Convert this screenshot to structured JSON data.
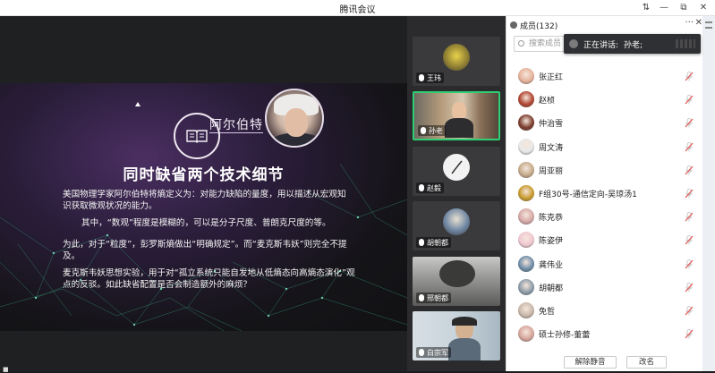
{
  "app": {
    "title": "腾讯会议",
    "window_controls": {
      "pin_icon": "pin-icon",
      "minimize": "—",
      "restore": "⧉",
      "close": "✕"
    }
  },
  "slide": {
    "person_name": "阿尔伯特",
    "headline": "同时缺省两个技术细节",
    "paragraphs": [
      "美国物理学家阿尔伯特将熵定义为：对能力缺陷的量度，用以描述从宏观知识获取微观状况的能力。",
      "其中，“数观”程度是模糊的，可以是分子尺度、普朗克尺度的等。",
      "为此，对于“粒度”，彭罗斯熵做出“明确规定”。而“麦克斯韦妖”则完全不提及。",
      "麦克斯韦妖思想实验，用于对“孤立系统只能自发地从低熵态向高熵态演化”观点的反驳。如此缺省配置是否会制造额外的麻烦？"
    ]
  },
  "video_tiles": [
    {
      "name": "王玮",
      "avatar_color": "#8a7a32",
      "active": false
    },
    {
      "name": "孙老",
      "avatar_color": "#b39a7a",
      "active": true
    },
    {
      "name": "赵毅",
      "avatar_color": "#eeeeee",
      "active": false
    },
    {
      "name": "胡朝都",
      "avatar_color": "#6f86a3",
      "active": false
    },
    {
      "name": "邢朝都",
      "avatar_color": "#9a9a98",
      "active": false
    },
    {
      "name": "白宗军",
      "avatar_color": "#c8d3db",
      "active": false
    }
  ],
  "members_panel": {
    "title": "成员(132)",
    "more": "···",
    "close": "✕",
    "search_placeholder": "搜索成员",
    "toast_prefix": "正在讲话:",
    "toast_speaker": "孙老;",
    "members": [
      {
        "name": "张正红",
        "avatar_color": "#e6b19a"
      },
      {
        "name": "赵桢",
        "avatar_color": "#b0432f"
      },
      {
        "name": "仲治雪",
        "avatar_color": "#7a3a2a"
      },
      {
        "name": "周文涛",
        "avatar_color": "#e8e8e8"
      },
      {
        "name": "周亚丽",
        "avatar_color": "#c6aa8a"
      },
      {
        "name": "F组30号-通信定向-吴琼汤1",
        "avatar_color": "#c89a2a"
      },
      {
        "name": "陈克恭",
        "avatar_color": "#d7a9a9"
      },
      {
        "name": "陈姿伊",
        "avatar_color": "#f0c8d0"
      },
      {
        "name": "龚伟业",
        "avatar_color": "#6c8ca8"
      },
      {
        "name": "胡朝都",
        "avatar_color": "#8b9ba8"
      },
      {
        "name": "免哲",
        "avatar_color": "#c9b7aa"
      },
      {
        "name": "硕士孙修-董蕾",
        "avatar_color": "#d6a59a"
      }
    ],
    "mute_all_label": "解除静音",
    "rename_label": "改名"
  },
  "colors": {
    "active_border": "#2ecf73",
    "mic_muted": "#e45050"
  }
}
